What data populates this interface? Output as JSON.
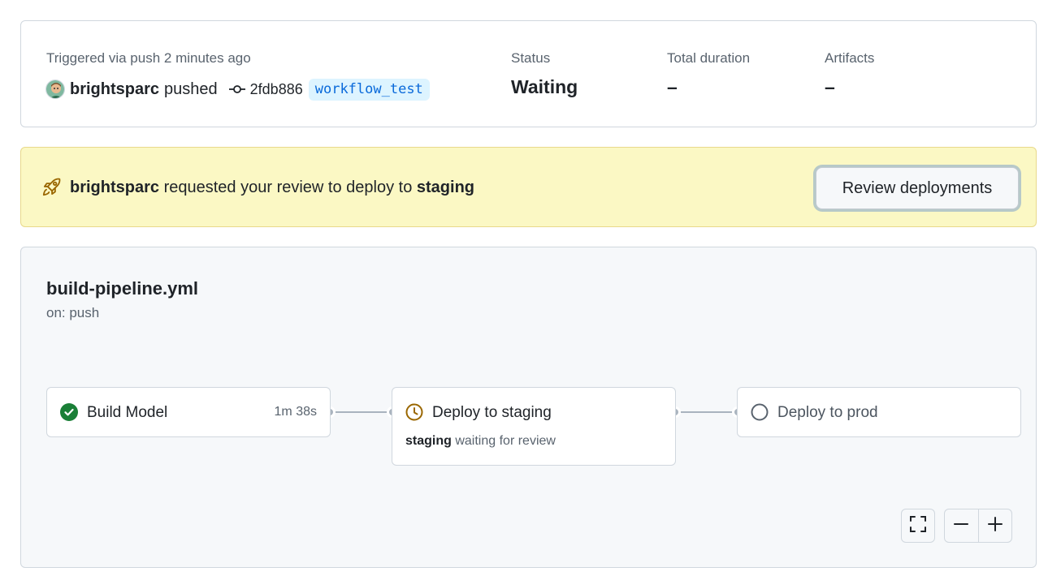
{
  "summary": {
    "trigger_label": "Triggered via push 2 minutes ago",
    "actor": "brightsparc",
    "action": "pushed",
    "commit_sha": "2fdb886",
    "branch": "workflow_test",
    "status_label": "Status",
    "status_value": "Waiting",
    "duration_label": "Total duration",
    "duration_value": "–",
    "artifacts_label": "Artifacts",
    "artifacts_value": "–"
  },
  "review_banner": {
    "actor": "brightsparc",
    "message": "requested your review to deploy to",
    "environment": "staging",
    "button_label": "Review deployments",
    "icon": "rocket-icon",
    "colors": {
      "background": "#fbf8c4",
      "icon": "#9a6700"
    }
  },
  "workflow": {
    "file": "build-pipeline.yml",
    "trigger": "on: push",
    "jobs": [
      {
        "name": "Build Model",
        "duration": "1m 38s",
        "status": "success",
        "icon": "check-circle-icon"
      },
      {
        "name": "Deploy to staging",
        "status": "waiting",
        "icon": "clock-icon",
        "env": "staging",
        "note": "waiting for review"
      },
      {
        "name": "Deploy to prod",
        "status": "pending",
        "icon": "empty-circle-icon"
      }
    ],
    "controls": {
      "fullscreen_icon": "fullscreen-icon",
      "zoom_out_icon": "minus-icon",
      "zoom_in_icon": "plus-icon"
    },
    "colors": {
      "success": "#1a7f37",
      "waiting": "#9a6700",
      "pending": "#59636e"
    }
  }
}
